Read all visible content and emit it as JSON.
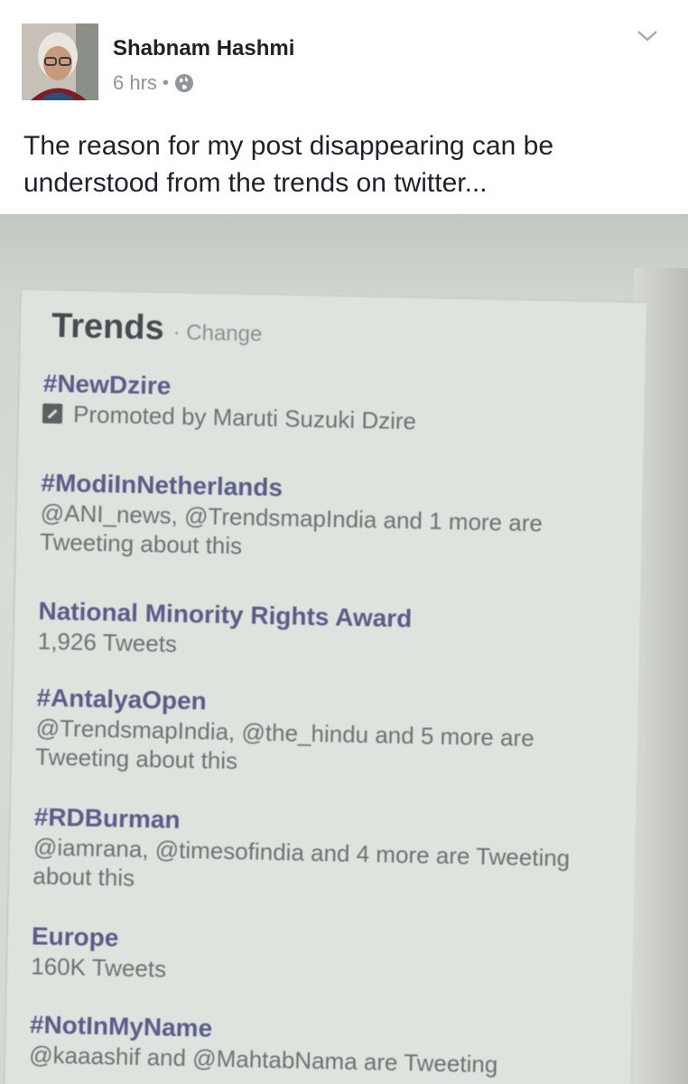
{
  "post": {
    "author": "Shabnam Hashmi",
    "time": "6 hrs",
    "separator": "•",
    "privacy_icon": "globe-icon",
    "menu_icon": "chevron-down-icon",
    "text": "The reason for my post disappearing can be understood from the trends on twitter..."
  },
  "photo": {
    "trends_title": "Trends",
    "trends_change": "· Change",
    "items": [
      {
        "name": "#NewDzire",
        "sub": "Promoted by Maruti Suzuki Dzire",
        "promoted": true
      },
      {
        "name": "#ModiInNetherlands",
        "sub": "@ANI_news, @TrendsmapIndia and 1 more are Tweeting about this"
      },
      {
        "name": "National Minority Rights Award",
        "sub": "1,926 Tweets"
      },
      {
        "name": "#AntalyaOpen",
        "sub": "@TrendsmapIndia, @the_hindu and 5 more are Tweeting about this"
      },
      {
        "name": "#RDBurman",
        "sub": "@iamrana, @timesofindia and 4 more are Tweeting about this"
      },
      {
        "name": "Europe",
        "sub": "160K Tweets"
      },
      {
        "name": "#NotInMyName",
        "sub": "@kaaashif and @MahtabNama are Tweeting"
      }
    ]
  },
  "colors": {
    "name": "#1d2129",
    "meta": "#90949c",
    "trend_link": "#5a5c8a"
  }
}
